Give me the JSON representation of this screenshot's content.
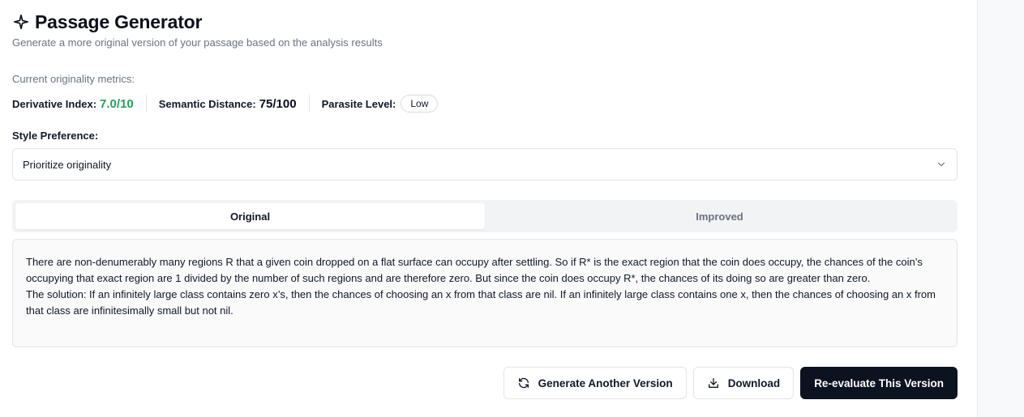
{
  "header": {
    "title": "Passage Generator",
    "subtitle": "Generate a more original version of your passage based on the analysis results",
    "title_icon": "sparkle-icon"
  },
  "metrics": {
    "caption": "Current originality metrics:",
    "derivative_label": "Derivative Index:",
    "derivative_value": "7.0/10",
    "semantic_label": "Semantic Distance:",
    "semantic_value": "75/100",
    "parasite_label": "Parasite Level:",
    "parasite_value": "Low",
    "colors": {
      "positive": "#22a35a"
    }
  },
  "style": {
    "label": "Style Preference:",
    "selected": "Prioritize originality"
  },
  "tabs": [
    {
      "label": "Original",
      "active": true
    },
    {
      "label": "Improved",
      "active": false
    }
  ],
  "passage": {
    "paragraph1": "There are non-denumerably many regions R that a given coin dropped on a flat surface can occupy after settling. So if R* is the exact region that the coin does occupy, the chances of the coin’s occupying that exact region are 1 divided by the number of such regions and are therefore zero. But since the coin does occupy R*, the chances of its doing so are greater than zero.",
    "paragraph2": "The solution: If an infinitely large class contains zero x’s, then the chances of choosing an x from that class are nil. If an infinitely large class contains one x, then the chances of choosing an x from that class are infinitesimally small but not nil."
  },
  "actions": {
    "generate": "Generate Another Version",
    "download": "Download",
    "reevaluate": "Re-evaluate This Version"
  },
  "colors": {
    "primary_button": "#0b1220"
  }
}
